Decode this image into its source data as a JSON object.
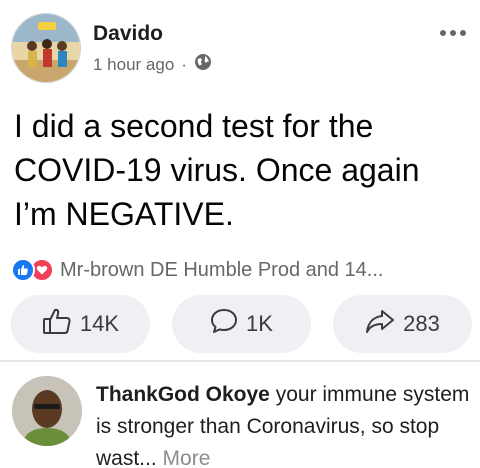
{
  "post": {
    "author": "Davido",
    "time": "1 hour ago",
    "separator": "·",
    "text": "I did a second test for the COVID-19 virus. Once again I’m NEGATIVE.",
    "reactions_text": "Mr-brown DE Humble Prod and 14..."
  },
  "actions": {
    "likes": "14K",
    "comments": "1K",
    "shares": "283"
  },
  "comment": {
    "author": "ThankGod Okoye",
    "text": " your immune system is stronger than Coronavirus, so stop wast...",
    "more_label": " More"
  },
  "colors": {
    "like_blue": "#1877f2",
    "love_red": "#f33e58",
    "secondary_text": "#65676b",
    "button_bg": "#eef0f3"
  },
  "icons": [
    "globe-icon",
    "more-options-icon",
    "like-reaction-icon",
    "love-reaction-icon",
    "thumbs-up-icon",
    "comment-icon",
    "share-icon"
  ]
}
